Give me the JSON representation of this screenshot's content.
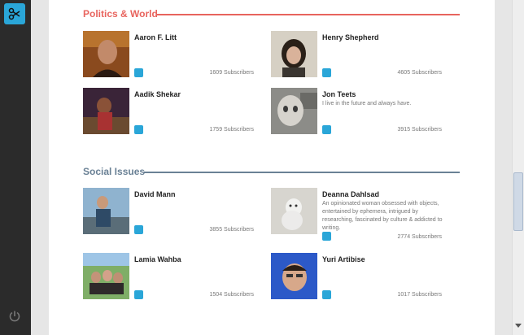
{
  "sections": [
    {
      "title": "Politics & World",
      "color": "#e8645e",
      "people": [
        {
          "name": "Aaron F. Litt",
          "bio": "",
          "subscribers": "1609 Subscribers"
        },
        {
          "name": "Henry Shepherd",
          "bio": "",
          "subscribers": "4605 Subscribers"
        },
        {
          "name": "Aadik Shekar",
          "bio": "",
          "subscribers": "1759 Subscribers"
        },
        {
          "name": "Jon Teets",
          "bio": "I live in the future and always have.",
          "subscribers": "3915 Subscribers"
        }
      ]
    },
    {
      "title": "Social Issues",
      "color": "#6a8195",
      "people": [
        {
          "name": "David Mann",
          "bio": "",
          "subscribers": "3855 Subscribers"
        },
        {
          "name": "Deanna Dahlsad",
          "bio": "An opinionated woman obsessed with objects, entertained by ephemera, intrigued by researching, fascinated by culture & addicted to writing.",
          "subscribers": "2774 Subscribers"
        },
        {
          "name": "Lamia Wahba",
          "bio": "",
          "subscribers": "1504 Subscribers"
        },
        {
          "name": "Yuri Artibise",
          "bio": "",
          "subscribers": "1017 Subscribers"
        }
      ]
    }
  ],
  "icons": {
    "logo": "scissors-icon",
    "power": "power-icon",
    "twitter": "twitter-icon"
  },
  "colors": {
    "sidebar": "#2b2b2b",
    "accent": "#2aa6d8"
  }
}
